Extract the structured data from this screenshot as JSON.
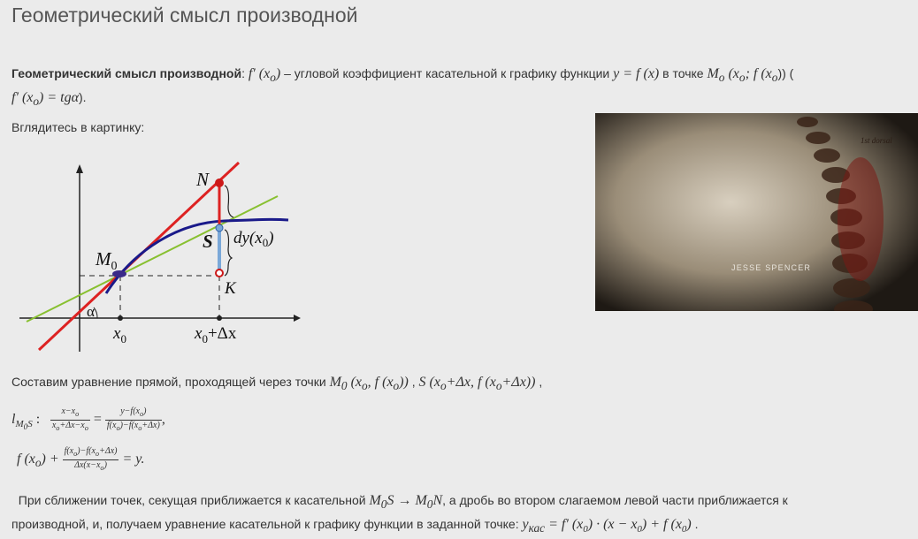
{
  "page_title": "Геометрический смысл производной",
  "def": {
    "term": "Геометрический смысл производной",
    "colon": ":",
    "fprime_x0": "f′ (x",
    "sub_o": "o",
    "close": ")",
    "text1": " – угловой коэффициент касательной к графику функции ",
    "y_eq_fx": "y = f (x)",
    "text2": " в точке ",
    "point": "M",
    "point_args": " (x",
    "point_args2": "; f (x",
    "point_close": ")) (",
    "line2": "f′ (x",
    "line2b": ") = tgα",
    "line2c": ")."
  },
  "look_text": "Вглядитесь в картинку:",
  "graph_labels": {
    "N": "N",
    "M0": "M",
    "M0_sub": "0",
    "S": "S",
    "K": "K",
    "dy": "dy(x",
    "dy_sub": "0",
    "dy_close": ")",
    "alpha": "α",
    "x0": "x",
    "x0_sub": "0",
    "x0dx": "x",
    "x0dx_sub": "0",
    "x0dx_tail": "+Δx"
  },
  "graph_colors": {
    "secant": "#dd2222",
    "tangent": "#88c030",
    "curve": "#1a1a8a",
    "dy_segment": "#7aa8d8"
  },
  "photo": {
    "caption": "JESSE SPENCER",
    "label": "1st dorsal"
  },
  "line_eq": {
    "text": "Составим уравнение прямой, проходящей через точки ",
    "p1": "M",
    "p1_sub": "0",
    "p1_args": " (x",
    "p1_args2": ", f (x",
    "p1_close": "))",
    "sep": " , ",
    "p2": "S (x",
    "p2_b": "+Δx, f (x",
    "p2_c": "+Δx))",
    "end": " ,"
  },
  "formula1": {
    "l": "l",
    "l_sub": "M",
    "l_sub2": "0",
    "l_sub3": "S",
    "colon": " :",
    "f1_num": "x−x",
    "f1_den": "x",
    "f1_den2": "+Δx−x",
    "eq": " = ",
    "f2_num": "y−f(x",
    "f2_num2": ")",
    "f2_den": "f(x",
    "f2_den2": ")−f(x",
    "f2_den3": "+Δx)",
    "comma": ","
  },
  "formula2": {
    "a": "f (x",
    "a2": ") +",
    "num": "f(x",
    "num2": ")−f(x",
    "num3": "+Δx)",
    "den": "Δx(x−x",
    "den2": ")",
    "tail": " = y."
  },
  "conclusion": {
    "text1": "При сближении точек, секущая приближается к касательной ",
    "ms": "M",
    "ms_sub": "0",
    "ms_s": "S",
    "arrow": " → ",
    "mn": "M",
    "mn_sub": "0",
    "mn_n": "N",
    "text2": ", а дробь во втором слагаемом левой части приближается к",
    "text3": "производной, и, получаем уравнение касательной к графику функции в заданной точке: ",
    "y": "y",
    "y_sub": "кас",
    "eq": " = f′ (x",
    "eq2": ") · (x − x",
    "eq3": ") + f (x",
    "eq4": ")",
    "end": " ."
  }
}
